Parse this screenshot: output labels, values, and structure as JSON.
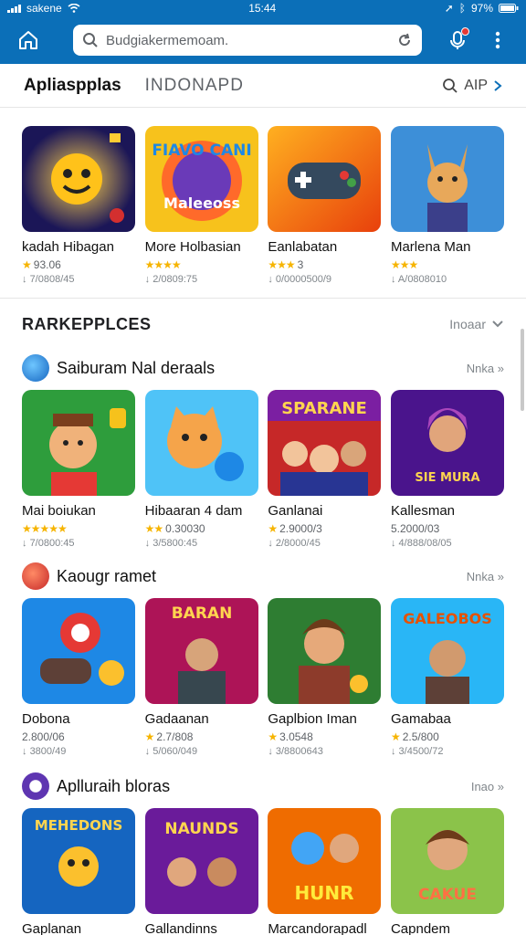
{
  "status": {
    "carrier": "sakene",
    "time": "15:44",
    "battery": "97%"
  },
  "search": {
    "value": "Budgiakermemoam."
  },
  "tabs": {
    "active": "Apliaspplas",
    "inactive": "INDONAPD",
    "tool_label": "AIP"
  },
  "top_apps": [
    {
      "title": "kadah Hibagan",
      "rating": "93.06",
      "downloads": "7/0808/45"
    },
    {
      "title": "More Holbasian",
      "rating": "",
      "downloads": "2/0809:75"
    },
    {
      "title": "Eanlabatan",
      "rating": "3",
      "downloads": "0/0000500/9"
    },
    {
      "title": "Marlena Man",
      "rating": "",
      "downloads": "A/0808010"
    }
  ],
  "section": {
    "heading": "RARKEPPLCES",
    "more_label": "Inoaar"
  },
  "groups": [
    {
      "name": "Saiburam Nal deraals",
      "more": "Nnka",
      "apps": [
        {
          "title": "Mai boiukan",
          "rating": "",
          "downloads": "7/0800:45"
        },
        {
          "title": "Hibaaran 4 dam",
          "rating": "0.30030",
          "downloads": "3/5800:45"
        },
        {
          "title": "Ganlanai",
          "rating": "2.9000/3",
          "downloads": "2/8000/45"
        },
        {
          "title": "Kallesman",
          "rating": "5.2000/03",
          "downloads": "4/888/08/05"
        }
      ]
    },
    {
      "name": "Kaougr ramet",
      "more": "Nnka",
      "apps": [
        {
          "title": "Dobona",
          "rating": "2.800/06",
          "downloads": "3800/49"
        },
        {
          "title": "Gadaanan",
          "rating": "2.7/808",
          "downloads": "5/060/049"
        },
        {
          "title": "Gaplbion Iman",
          "rating": "3.0548",
          "downloads": "3/8800643"
        },
        {
          "title": "Gamabaa",
          "rating": "2.5/800",
          "downloads": "3/4500/72"
        }
      ]
    },
    {
      "name": "Aplluraih bloras",
      "more": "Inao",
      "apps": [
        {
          "title": "Gaplanan",
          "rating": "",
          "downloads": ""
        },
        {
          "title": "Gallandinns",
          "rating": "",
          "downloads": ""
        },
        {
          "title": "Marcandorapadl",
          "rating": "",
          "downloads": ""
        },
        {
          "title": "Capndem",
          "rating": "",
          "downloads": ""
        }
      ]
    }
  ],
  "thumb_text": {
    "t1": "FIAVO CANI",
    "t2": "Maleeoss",
    "g1a": "SPARANE",
    "g1b": "SIE MURA",
    "g2a": "BARAN",
    "g2b": "GALEOBOS",
    "g3a": "MEHEDONS",
    "g3b": "NAUNDS",
    "g3c": "HUNR",
    "g3d": "CAKUE"
  },
  "colors": {
    "brand": "#0b6fb8",
    "star": "#f6b400"
  }
}
